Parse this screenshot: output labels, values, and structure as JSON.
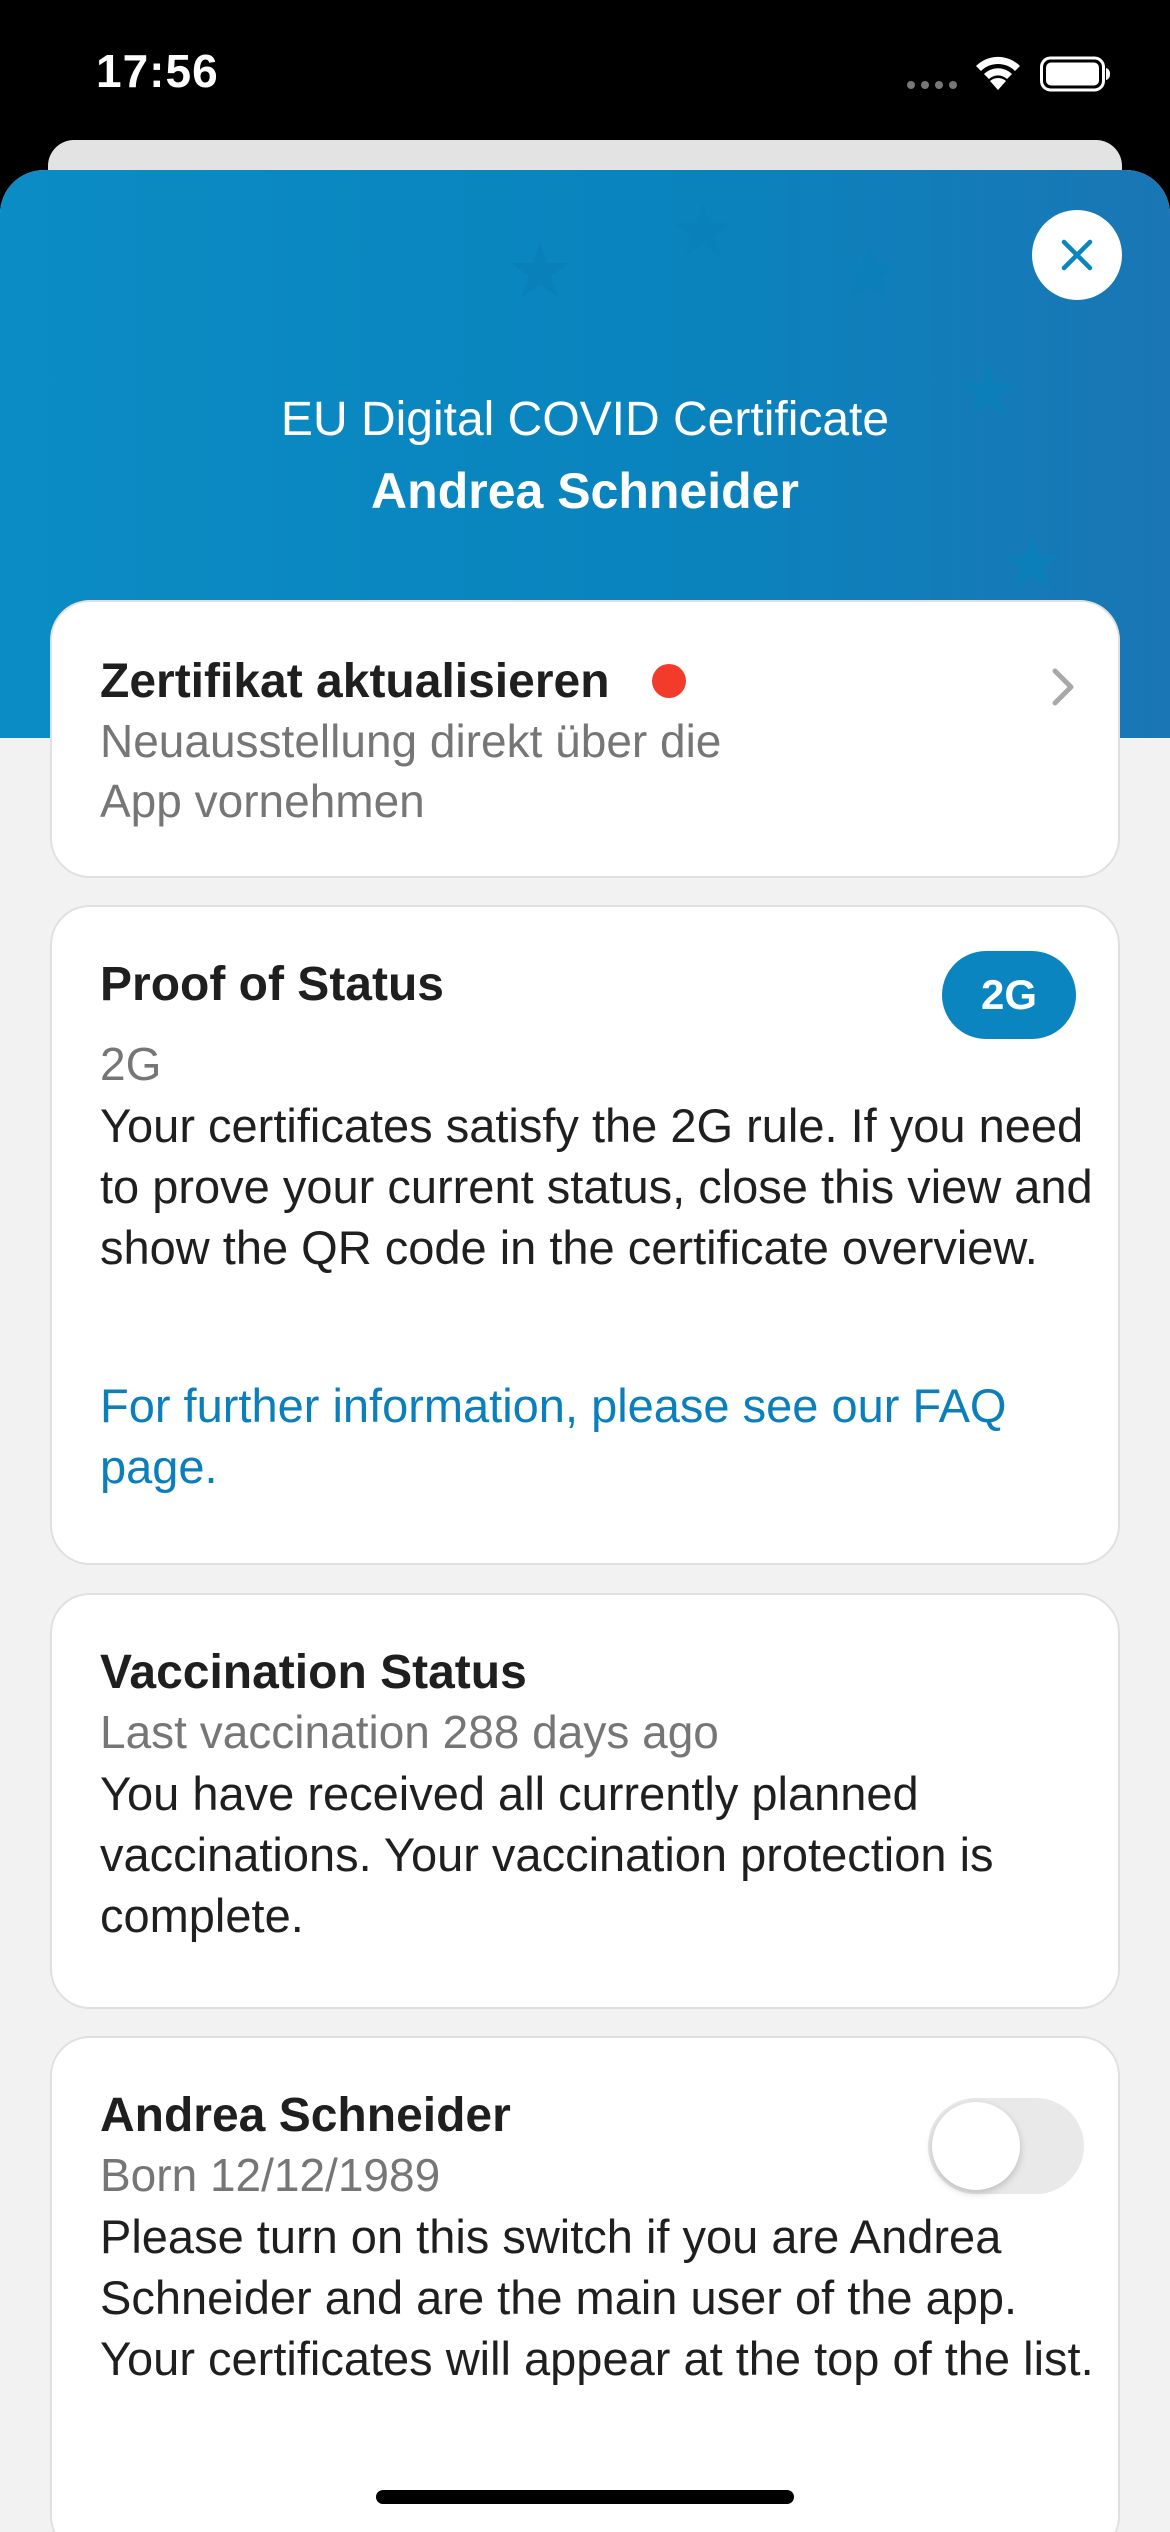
{
  "status_bar": {
    "time": "17:56"
  },
  "header": {
    "close_icon": "close-icon",
    "title": "EU Digital COVID Certificate",
    "name": "Andrea Schneider",
    "colors": {
      "start": "#0b8cc4",
      "end": "#1a76b5",
      "star": "#0a80ba"
    }
  },
  "update_card": {
    "title": "Zertifikat aktualisieren",
    "subtitle_line1": "Neuausstellung direkt über die",
    "subtitle_line2": "App vornehmen",
    "indicator_color": "#f33b2c"
  },
  "proof_card": {
    "title": "Proof of Status",
    "status": "2G",
    "badge": "2G",
    "body": "Your certificates satisfy the 2G rule. If you need to prove your current status, close this view and show the QR code in the certificate overview.",
    "link": "For further information, please see our FAQ page.",
    "link_color": "#0a7fbc"
  },
  "vaccination_card": {
    "title": "Vaccination Status",
    "subtitle": "Last vaccination 288 days ago",
    "body": "You have received all currently planned vaccinations. Your vaccination protection is complete."
  },
  "owner_card": {
    "name": "Andrea Schneider",
    "born": "Born 12/12/1989",
    "toggle_on": false,
    "body": "Please turn on this switch if you are Andrea Schneider and are the main user of the app. Your certificates will appear at the top of the list."
  }
}
